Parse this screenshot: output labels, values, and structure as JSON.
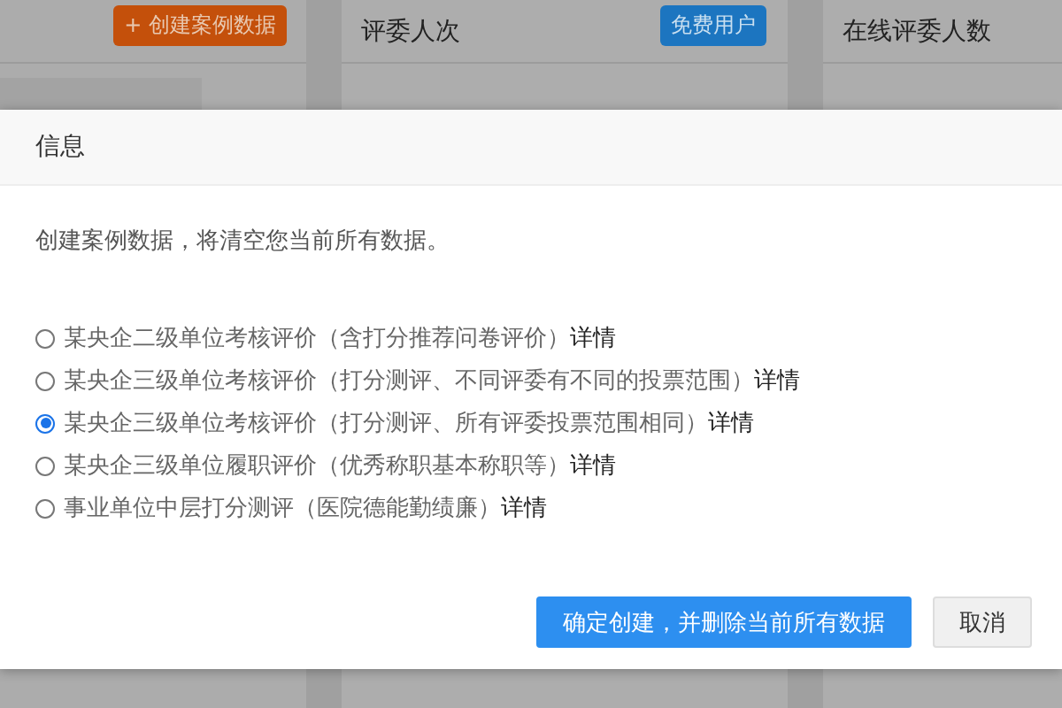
{
  "background": {
    "create_case_button": "+ 创建案例数据",
    "cards": [
      {
        "title": "评委人次",
        "badge": "免费用户"
      },
      {
        "title": "在线评委人数"
      }
    ]
  },
  "dialog": {
    "title": "信息",
    "message": "创建案例数据，将清空您当前所有数据。",
    "options": [
      {
        "label": "某央企二级单位考核评价（含打分推荐问卷评价）",
        "link": "详情",
        "selected": false
      },
      {
        "label": "某央企三级单位考核评价（打分测评、不同评委有不同的投票范围）",
        "link": "详情",
        "selected": false
      },
      {
        "label": "某央企三级单位考核评价（打分测评、所有评委投票范围相同）",
        "link": "详情",
        "selected": true
      },
      {
        "label": "某央企三级单位履职评价（优秀称职基本称职等）",
        "link": "详情",
        "selected": false
      },
      {
        "label": "事业单位中层打分测评（医院德能勤绩廉）",
        "link": "详情",
        "selected": false
      }
    ],
    "buttons": [
      {
        "label": "确定创建，并删除当前所有数据",
        "kind": "primary"
      },
      {
        "label": "取消",
        "kind": "secondary"
      }
    ]
  }
}
